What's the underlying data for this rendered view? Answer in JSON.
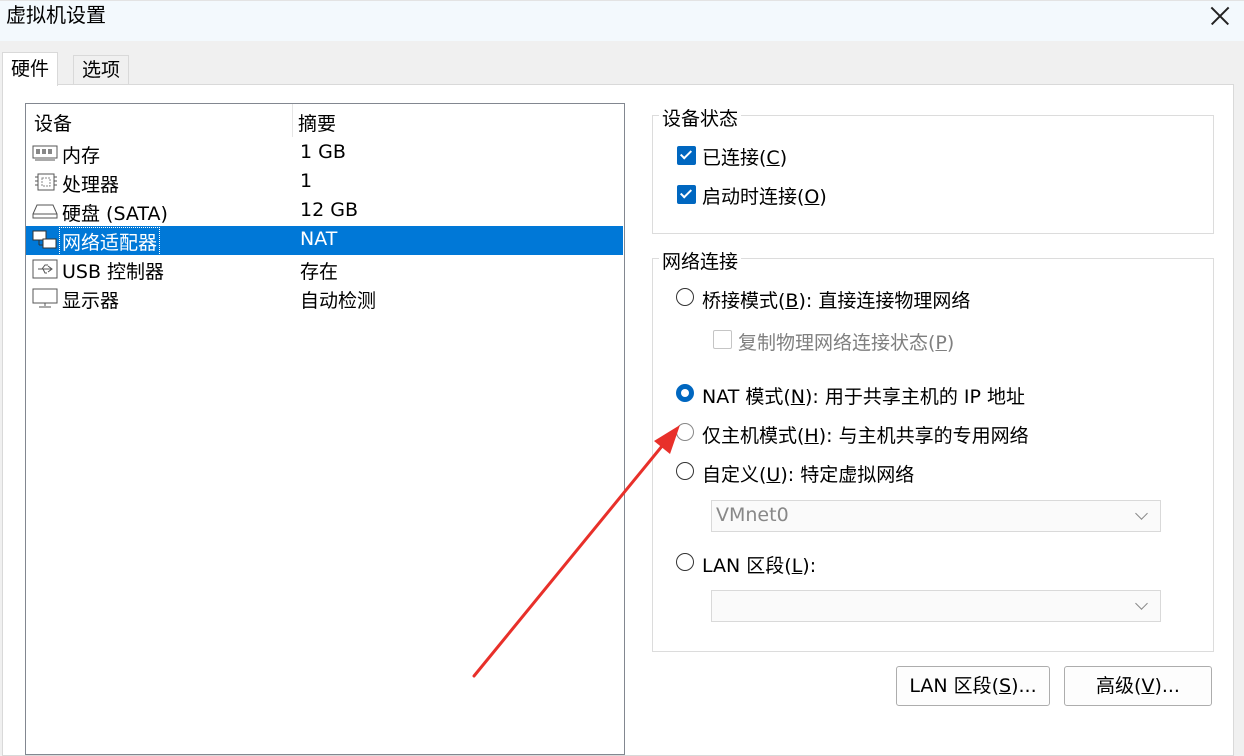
{
  "window": {
    "title": "虚拟机设置"
  },
  "tabs": [
    {
      "label": "硬件"
    },
    {
      "label": "选项"
    }
  ],
  "device_list": {
    "headers": {
      "device": "设备",
      "summary": "摘要"
    },
    "rows": [
      {
        "name": "内存",
        "summary": "1 GB",
        "icon": "memory-icon"
      },
      {
        "name": "处理器",
        "summary": "1",
        "icon": "processor-icon"
      },
      {
        "name": "硬盘 (SATA)",
        "summary": "12 GB",
        "icon": "hard-disk-icon"
      },
      {
        "name": "网络适配器",
        "summary": "NAT",
        "icon": "network-adapter-icon",
        "selected": true
      },
      {
        "name": "USB 控制器",
        "summary": "存在",
        "icon": "usb-icon"
      },
      {
        "name": "显示器",
        "summary": "自动检测",
        "icon": "monitor-icon"
      }
    ]
  },
  "device_status": {
    "label": "设备状态",
    "connected": {
      "pre": "已连接(",
      "key": "C",
      "post": ")",
      "checked": true
    },
    "connect_at_power_on": {
      "pre": "启动时连接(",
      "key": "O",
      "post": ")",
      "checked": true
    }
  },
  "network_connection": {
    "label": "网络连接",
    "bridged": {
      "pre": "桥接模式(",
      "key": "B",
      "post": "): 直接连接物理网络",
      "selected": false
    },
    "replicate": {
      "pre": "复制物理网络连接状态(",
      "key": "P",
      "post": ")",
      "checked": false
    },
    "nat": {
      "pre": "NAT 模式(",
      "key": "N",
      "post": "): 用于共享主机的 IP 地址",
      "selected": true
    },
    "host_only": {
      "pre": "仅主机模式(",
      "key": "H",
      "post": "): 与主机共享的专用网络",
      "selected": false
    },
    "custom": {
      "pre": "自定义(",
      "key": "U",
      "post": "): 特定虚拟网络",
      "selected": false
    },
    "custom_value": "VMnet0",
    "lan_segment": {
      "pre": "LAN 区段(",
      "key": "L",
      "post": "):",
      "selected": false
    },
    "lan_value": ""
  },
  "buttons": {
    "lan_segments": {
      "pre": "LAN 区段(",
      "key": "S",
      "post": ")..."
    },
    "advanced": {
      "pre": "高级(",
      "key": "V",
      "post": ")..."
    }
  },
  "annotation": {
    "arrow_color": "#e8302a"
  },
  "colors": {
    "selection": "#0078d7",
    "accent": "#0067c0"
  }
}
